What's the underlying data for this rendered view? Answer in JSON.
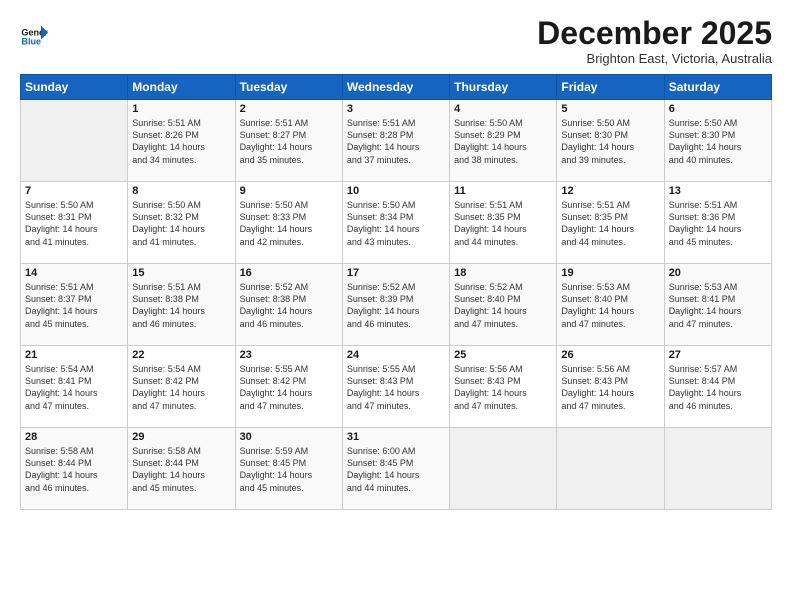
{
  "header": {
    "logo_general": "General",
    "logo_blue": "Blue",
    "month": "December 2025",
    "location": "Brighton East, Victoria, Australia"
  },
  "days_of_week": [
    "Sunday",
    "Monday",
    "Tuesday",
    "Wednesday",
    "Thursday",
    "Friday",
    "Saturday"
  ],
  "weeks": [
    [
      {
        "day": "",
        "content": ""
      },
      {
        "day": "1",
        "content": "Sunrise: 5:51 AM\nSunset: 8:26 PM\nDaylight: 14 hours\nand 34 minutes."
      },
      {
        "day": "2",
        "content": "Sunrise: 5:51 AM\nSunset: 8:27 PM\nDaylight: 14 hours\nand 35 minutes."
      },
      {
        "day": "3",
        "content": "Sunrise: 5:51 AM\nSunset: 8:28 PM\nDaylight: 14 hours\nand 37 minutes."
      },
      {
        "day": "4",
        "content": "Sunrise: 5:50 AM\nSunset: 8:29 PM\nDaylight: 14 hours\nand 38 minutes."
      },
      {
        "day": "5",
        "content": "Sunrise: 5:50 AM\nSunset: 8:30 PM\nDaylight: 14 hours\nand 39 minutes."
      },
      {
        "day": "6",
        "content": "Sunrise: 5:50 AM\nSunset: 8:30 PM\nDaylight: 14 hours\nand 40 minutes."
      }
    ],
    [
      {
        "day": "7",
        "content": "Sunrise: 5:50 AM\nSunset: 8:31 PM\nDaylight: 14 hours\nand 41 minutes."
      },
      {
        "day": "8",
        "content": "Sunrise: 5:50 AM\nSunset: 8:32 PM\nDaylight: 14 hours\nand 41 minutes."
      },
      {
        "day": "9",
        "content": "Sunrise: 5:50 AM\nSunset: 8:33 PM\nDaylight: 14 hours\nand 42 minutes."
      },
      {
        "day": "10",
        "content": "Sunrise: 5:50 AM\nSunset: 8:34 PM\nDaylight: 14 hours\nand 43 minutes."
      },
      {
        "day": "11",
        "content": "Sunrise: 5:51 AM\nSunset: 8:35 PM\nDaylight: 14 hours\nand 44 minutes."
      },
      {
        "day": "12",
        "content": "Sunrise: 5:51 AM\nSunset: 8:35 PM\nDaylight: 14 hours\nand 44 minutes."
      },
      {
        "day": "13",
        "content": "Sunrise: 5:51 AM\nSunset: 8:36 PM\nDaylight: 14 hours\nand 45 minutes."
      }
    ],
    [
      {
        "day": "14",
        "content": "Sunrise: 5:51 AM\nSunset: 8:37 PM\nDaylight: 14 hours\nand 45 minutes."
      },
      {
        "day": "15",
        "content": "Sunrise: 5:51 AM\nSunset: 8:38 PM\nDaylight: 14 hours\nand 46 minutes."
      },
      {
        "day": "16",
        "content": "Sunrise: 5:52 AM\nSunset: 8:38 PM\nDaylight: 14 hours\nand 46 minutes."
      },
      {
        "day": "17",
        "content": "Sunrise: 5:52 AM\nSunset: 8:39 PM\nDaylight: 14 hours\nand 46 minutes."
      },
      {
        "day": "18",
        "content": "Sunrise: 5:52 AM\nSunset: 8:40 PM\nDaylight: 14 hours\nand 47 minutes."
      },
      {
        "day": "19",
        "content": "Sunrise: 5:53 AM\nSunset: 8:40 PM\nDaylight: 14 hours\nand 47 minutes."
      },
      {
        "day": "20",
        "content": "Sunrise: 5:53 AM\nSunset: 8:41 PM\nDaylight: 14 hours\nand 47 minutes."
      }
    ],
    [
      {
        "day": "21",
        "content": "Sunrise: 5:54 AM\nSunset: 8:41 PM\nDaylight: 14 hours\nand 47 minutes."
      },
      {
        "day": "22",
        "content": "Sunrise: 5:54 AM\nSunset: 8:42 PM\nDaylight: 14 hours\nand 47 minutes."
      },
      {
        "day": "23",
        "content": "Sunrise: 5:55 AM\nSunset: 8:42 PM\nDaylight: 14 hours\nand 47 minutes."
      },
      {
        "day": "24",
        "content": "Sunrise: 5:55 AM\nSunset: 8:43 PM\nDaylight: 14 hours\nand 47 minutes."
      },
      {
        "day": "25",
        "content": "Sunrise: 5:56 AM\nSunset: 8:43 PM\nDaylight: 14 hours\nand 47 minutes."
      },
      {
        "day": "26",
        "content": "Sunrise: 5:56 AM\nSunset: 8:43 PM\nDaylight: 14 hours\nand 47 minutes."
      },
      {
        "day": "27",
        "content": "Sunrise: 5:57 AM\nSunset: 8:44 PM\nDaylight: 14 hours\nand 46 minutes."
      }
    ],
    [
      {
        "day": "28",
        "content": "Sunrise: 5:58 AM\nSunset: 8:44 PM\nDaylight: 14 hours\nand 46 minutes."
      },
      {
        "day": "29",
        "content": "Sunrise: 5:58 AM\nSunset: 8:44 PM\nDaylight: 14 hours\nand 45 minutes."
      },
      {
        "day": "30",
        "content": "Sunrise: 5:59 AM\nSunset: 8:45 PM\nDaylight: 14 hours\nand 45 minutes."
      },
      {
        "day": "31",
        "content": "Sunrise: 6:00 AM\nSunset: 8:45 PM\nDaylight: 14 hours\nand 44 minutes."
      },
      {
        "day": "",
        "content": ""
      },
      {
        "day": "",
        "content": ""
      },
      {
        "day": "",
        "content": ""
      }
    ]
  ]
}
